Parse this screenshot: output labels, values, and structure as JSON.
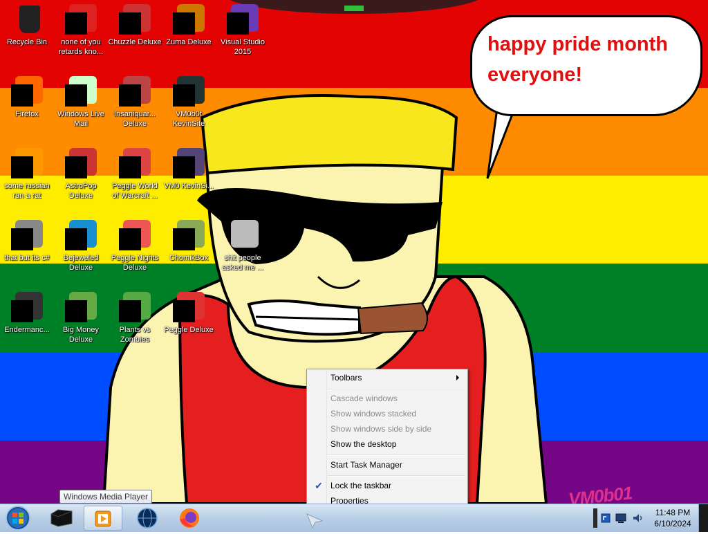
{
  "desktop": {
    "speech_bubble": "happy pride month everyone!",
    "signature": "VM0b01",
    "icons": [
      {
        "label": "Recycle Bin",
        "icon": "recycle-bin-icon"
      },
      {
        "label": "none of you retards kno...",
        "icon": "app-icon"
      },
      {
        "label": "Chuzzle Deluxe",
        "icon": "game-icon"
      },
      {
        "label": "Zuma Deluxe",
        "icon": "game-icon"
      },
      {
        "label": "Visual Studio 2015",
        "icon": "visual-studio-icon"
      },
      {
        "label": "Firefox",
        "icon": "firefox-icon"
      },
      {
        "label": "Windows Live Mail",
        "icon": "mail-icon"
      },
      {
        "label": "Insaniquar... Deluxe",
        "icon": "game-icon"
      },
      {
        "label": "VM0b0t KevinSite",
        "icon": "shortcut-icon"
      },
      {
        "label": "some russian ran a rat",
        "icon": "app-icon"
      },
      {
        "label": "AstroPop Deluxe",
        "icon": "game-icon"
      },
      {
        "label": "Peggle World of Warcraft ...",
        "icon": "game-icon"
      },
      {
        "label": "VM0 KevinSi...",
        "icon": "shortcut-icon"
      },
      {
        "label": "that but its c#",
        "icon": "file-icon"
      },
      {
        "label": "Bejeweled Deluxe",
        "icon": "game-icon"
      },
      {
        "label": "Peggle Nights Deluxe",
        "icon": "game-icon"
      },
      {
        "label": "ChomikBox",
        "icon": "app-icon"
      },
      {
        "label": "shit people asked me ...",
        "icon": "folder-icon"
      },
      {
        "label": "Endermanc...",
        "icon": "app-icon"
      },
      {
        "label": "Big Money Deluxe",
        "icon": "game-icon"
      },
      {
        "label": "Plants vs Zombies",
        "icon": "game-icon"
      },
      {
        "label": "Peggle Deluxe",
        "icon": "game-icon"
      }
    ]
  },
  "context_menu": {
    "toolbars": "Toolbars",
    "cascade": "Cascade windows",
    "stacked": "Show windows stacked",
    "side_by_side": "Show windows side by side",
    "show_desktop": "Show the desktop",
    "task_manager": "Start Task Manager",
    "lock_taskbar": "Lock the taskbar",
    "lock_checked": true,
    "properties": "Properties"
  },
  "tooltip": "Windows Media Player",
  "taskbar": {
    "pinned": [
      {
        "name": "app-pinned",
        "icon": "black-box-icon"
      },
      {
        "name": "windows-media-player",
        "icon": "media-player-icon"
      },
      {
        "name": "globe-app",
        "icon": "globe-icon"
      },
      {
        "name": "firefox",
        "icon": "firefox-icon"
      }
    ],
    "clock": {
      "time": "11:48 PM",
      "date": "6/10/2024"
    }
  },
  "colors": {
    "stripes": [
      "#e40303",
      "#ff8c00",
      "#ffed00",
      "#008026",
      "#004dff",
      "#750787"
    ],
    "bubble_text": "#e01010",
    "skin": "#fbf4b0",
    "hat": "#f7e71c",
    "shirt": "#e51f1f"
  }
}
